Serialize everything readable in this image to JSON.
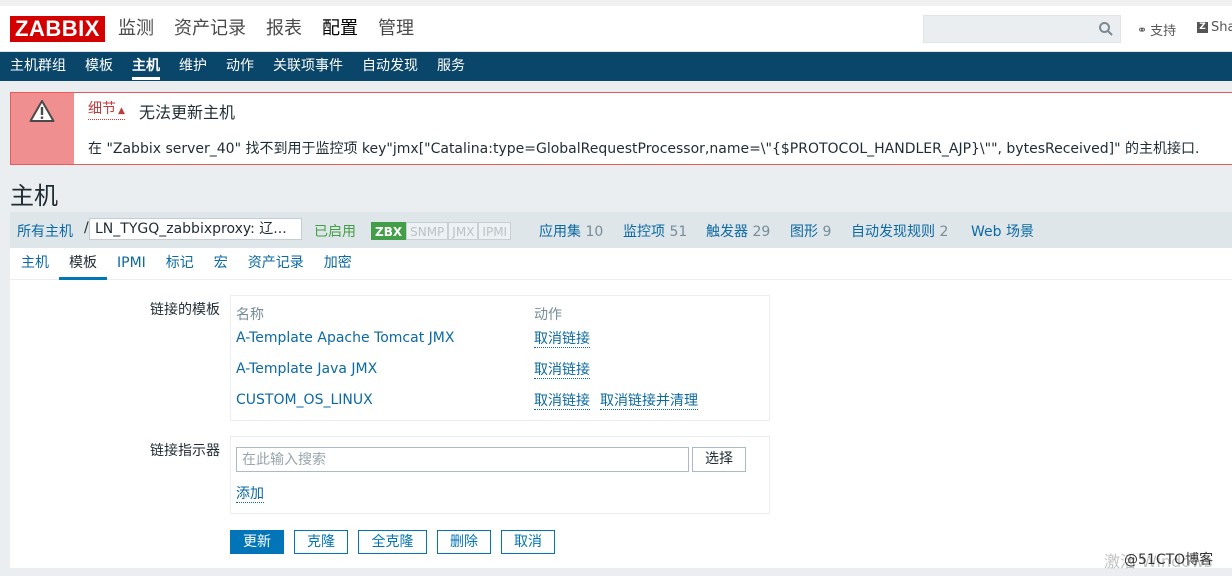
{
  "logo": "ZABBIX",
  "main_nav": [
    "监测",
    "资产记录",
    "报表",
    "配置",
    "管理"
  ],
  "header_right": {
    "support": "支持",
    "share": "Sha"
  },
  "sub_nav": [
    "主机群组",
    "模板",
    "主机",
    "维护",
    "动作",
    "关联项事件",
    "自动发现",
    "服务"
  ],
  "message": {
    "details": "细节",
    "title": "无法更新主机",
    "text": "在 \"Zabbix server_40\" 找不到用于监控项 key\"jmx[\"Catalina:type=GlobalRequestProcessor,name=\\\"{$PROTOCOL_HANDLER_AJP}\\\"\", bytesReceived]\" 的主机接口."
  },
  "page_title": "主机",
  "hostbar": {
    "all_hosts": "所有主机",
    "separator": "/",
    "host_name": "LN_TYGQ_zabbixproxy: 辽...",
    "status": "已启用",
    "availability": [
      "ZBX",
      "SNMP",
      "JMX",
      "IPMI"
    ],
    "links": [
      {
        "label": "应用集",
        "count": "10"
      },
      {
        "label": "监控项",
        "count": "51"
      },
      {
        "label": "触发器",
        "count": "29"
      },
      {
        "label": "图形",
        "count": "9"
      },
      {
        "label": "自动发现规则",
        "count": "2"
      },
      {
        "label": "Web 场景",
        "count": ""
      }
    ]
  },
  "tabs": [
    "主机",
    "模板",
    "IPMI",
    "标记",
    "宏",
    "资产记录",
    "加密"
  ],
  "linked_templates": {
    "label": "链接的模板",
    "col_name": "名称",
    "col_action": "动作",
    "rows": [
      {
        "name": "A-Template Apache Tomcat JMX",
        "unlink": "取消链接"
      },
      {
        "name": "A-Template Java JMX",
        "unlink": "取消链接"
      },
      {
        "name": "CUSTOM_OS_LINUX",
        "unlink": "取消链接",
        "unlink_clear": "取消链接并清理"
      }
    ]
  },
  "link_indicator": {
    "label": "链接指示器",
    "placeholder": "在此输入搜索",
    "select": "选择",
    "add": "添加"
  },
  "buttons": {
    "update": "更新",
    "clone": "克隆",
    "full_clone": "全克隆",
    "delete": "删除",
    "cancel": "取消"
  },
  "watermark": "激活 Windows",
  "watermark2": "@51CTO博客",
  "colors": {
    "header_nav": "#0a466a",
    "error_border": "#e75a5a",
    "link": "#0b69a3",
    "primary": "#0275b8",
    "logo": "#d40000"
  }
}
